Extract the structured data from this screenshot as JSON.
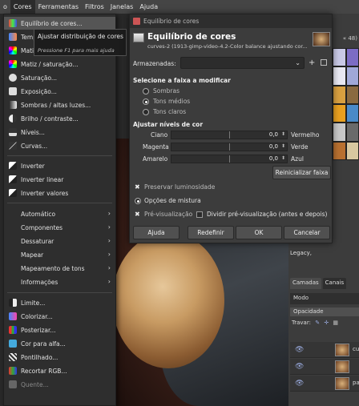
{
  "menubar": {
    "items": [
      {
        "label": "o",
        "active": false
      },
      {
        "label": "Cores",
        "active": true
      },
      {
        "label": "Ferramentas",
        "active": false
      },
      {
        "label": "Filtros",
        "active": false
      },
      {
        "label": "Janelas",
        "active": false
      },
      {
        "label": "Ajuda",
        "active": false
      }
    ]
  },
  "menu": {
    "items": [
      {
        "label": "Equilíbrio de cores...",
        "icon": "color-balance-icon",
        "highlighted": true
      },
      {
        "label": "Temp",
        "icon": "temperature-icon"
      },
      {
        "label": "Matiz",
        "icon": "hue-icon"
      },
      {
        "label": "Matiz / saturação...",
        "icon": "hue-saturation-icon"
      },
      {
        "label": "Saturação...",
        "icon": "saturation-icon"
      },
      {
        "label": "Exposição...",
        "icon": "exposure-icon"
      },
      {
        "label": "Sombras / altas luzes...",
        "icon": "shadows-highlights-icon"
      },
      {
        "label": "Brilho / contraste...",
        "icon": "brightness-contrast-icon"
      },
      {
        "label": "Níveis...",
        "icon": "levels-icon"
      },
      {
        "label": "Curvas...",
        "icon": "curves-icon"
      },
      {
        "label": "Inverter",
        "icon": "invert-icon"
      },
      {
        "label": "Inverter linear",
        "icon": "linear-invert-icon"
      },
      {
        "label": "Inverter valores",
        "icon": "value-invert-icon"
      },
      {
        "label": "Automático",
        "submenu": true
      },
      {
        "label": "Componentes",
        "submenu": true
      },
      {
        "label": "Dessaturar",
        "submenu": true
      },
      {
        "label": "Mapear",
        "submenu": true
      },
      {
        "label": "Mapeamento de tons",
        "submenu": true
      },
      {
        "label": "Informações",
        "submenu": true
      },
      {
        "label": "Limite...",
        "icon": "threshold-icon"
      },
      {
        "label": "Colorizar...",
        "icon": "colorize-icon"
      },
      {
        "label": "Posterizar...",
        "icon": "posterize-icon"
      },
      {
        "label": "Cor para alfa...",
        "icon": "color-to-alpha-icon"
      },
      {
        "label": "Pontilhado...",
        "icon": "dither-icon"
      },
      {
        "label": "Recortar RGB...",
        "icon": "rgb-clip-icon"
      },
      {
        "label": "Quente...",
        "icon": "hot-icon",
        "disabled": true
      }
    ]
  },
  "tooltip": {
    "text": "Ajustar distribuição de cores",
    "hint": "Pressione F1 para mais ajuda"
  },
  "dialog": {
    "window_title": "Equilíbrio de cores",
    "title": "Equilíbrio de cores",
    "subtitle": "curves-2 (1913-gimp-video-4.2-Color balance ajustando cor...",
    "presets_label": "Armazenadas:",
    "presets_value": "",
    "range_section": "Selecione a faixa a modificar",
    "ranges": [
      {
        "label": "Sombras",
        "selected": false
      },
      {
        "label": "Tons médios",
        "selected": true
      },
      {
        "label": "Tons claros",
        "selected": false
      }
    ],
    "levels_section": "Ajustar níveis de cor",
    "sliders": [
      {
        "left": "Ciano",
        "right": "Vermelho",
        "value": "0,0"
      },
      {
        "left": "Magenta",
        "right": "Verde",
        "value": "0,0"
      },
      {
        "left": "Amarelo",
        "right": "Azul",
        "value": "0,0"
      }
    ],
    "reset_label": "Reinicializar faixa",
    "preserve_label": "Preservar luminosidade",
    "preserve_checked": true,
    "blend_label": "Opções de mistura",
    "preview_label": "Pré-visualização",
    "preview_checked": true,
    "split_label": "Dividir pré-visualização (antes e depois)",
    "split_checked": false,
    "buttons": {
      "help": "Ajuda",
      "reset": "Redefinir",
      "ok": "OK",
      "cancel": "Cancelar"
    }
  },
  "right_panel": {
    "size_label": "« 48)",
    "legacy": "Legacy,",
    "tabs": [
      "Camadas",
      "Canais"
    ],
    "mode_label": "Modo",
    "opacity_label": "Opacidade",
    "lock_label": "Travar:",
    "layers": [
      {
        "name": "cu"
      },
      {
        "name": ""
      },
      {
        "name": "pa"
      }
    ]
  }
}
